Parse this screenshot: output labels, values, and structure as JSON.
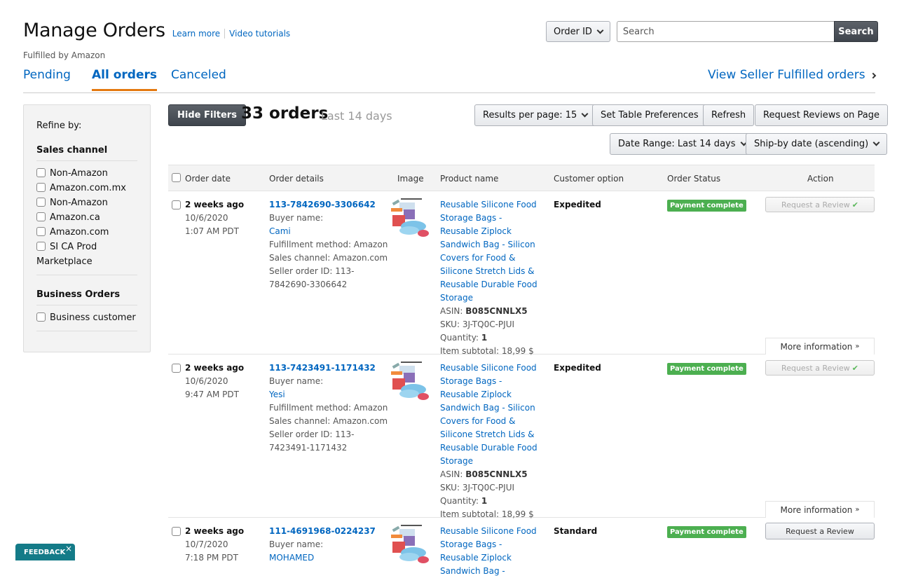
{
  "header": {
    "title": "Manage Orders",
    "learn_more": "Learn more",
    "video_tutorials": "Video tutorials",
    "subtitle": "Fulfilled by Amazon"
  },
  "search": {
    "field_select": "Order ID",
    "placeholder": "Search",
    "button": "Search"
  },
  "tabs": [
    {
      "label": "Pending",
      "active": false
    },
    {
      "label": "All orders",
      "active": true
    },
    {
      "label": "Canceled",
      "active": false
    }
  ],
  "view_seller_link": "View Seller Fulfilled orders",
  "filters": {
    "refine_label": "Refine by:",
    "groups": [
      {
        "title": "Sales channel",
        "options": [
          "Non-Amazon",
          "Amazon.com.mx",
          "Non-Amazon",
          "Amazon.ca",
          "Amazon.com",
          "SI CA Prod Marketplace"
        ]
      },
      {
        "title": "Business Orders",
        "options": [
          "Business customer"
        ]
      }
    ]
  },
  "toolbar": {
    "hide_filters": "Hide Filters",
    "order_count": "33 orders",
    "range_label": "Last 14 days",
    "results_per_page": "Results per page: 15",
    "set_table_prefs": "Set Table Preferences",
    "refresh": "Refresh",
    "request_reviews_page": "Request Reviews on Page",
    "date_range": "Date Range: Last 14 days",
    "sort": "Ship-by date (ascending)"
  },
  "table": {
    "columns": [
      "Order date",
      "Order details",
      "Image",
      "Product name",
      "Customer option",
      "Order Status",
      "Action"
    ],
    "labels": {
      "buyer_name": "Buyer name:",
      "fulfillment": "Fulfillment method: Amazon",
      "sales_channel": "Sales channel: Amazon.com",
      "seller_order_id": "Seller order ID:",
      "asin": "ASIN:",
      "sku": "SKU:",
      "quantity": "Quantity:",
      "subtotal": "Item subtotal:",
      "request_review": "Request a Review",
      "more_info": "More information"
    },
    "rows": [
      {
        "ago": "2 weeks ago",
        "date": "10/6/2020",
        "time": "1:07 AM PDT",
        "order_id": "113-7842690-3306642",
        "buyer": "Cami",
        "seller_order_id_a": "Seller order ID: 113-",
        "seller_order_id_b": "7842690-3306642",
        "product": "Reusable Silicone Food Storage Bags - Reusable Ziplock Sandwich Bag - Silicon Covers for Food & Silicone Stretch Lids & Reusable Durable Food Storage",
        "asin": "B085CNNLX5",
        "sku": "3J-TQ0C-PJUI",
        "quantity": "1",
        "subtotal": "18,99 $",
        "customer_option": "Expedited",
        "status": "Payment complete",
        "review_requested": true
      },
      {
        "ago": "2 weeks ago",
        "date": "10/6/2020",
        "time": "9:47 AM PDT",
        "order_id": "113-7423491-1171432",
        "buyer": "Yesi",
        "seller_order_id_a": "Seller order ID: 113-",
        "seller_order_id_b": "7423491-1171432",
        "product": "Reusable Silicone Food Storage Bags - Reusable Ziplock Sandwich Bag - Silicon Covers for Food & Silicone Stretch Lids & Reusable Durable Food Storage",
        "asin": "B085CNNLX5",
        "sku": "3J-TQ0C-PJUI",
        "quantity": "1",
        "subtotal": "18,99 $",
        "customer_option": "Expedited",
        "status": "Payment complete",
        "review_requested": true
      },
      {
        "ago": "2 weeks ago",
        "date": "10/7/2020",
        "time": "7:18 PM PDT",
        "order_id": "111-4691968-0224237",
        "buyer": "MOHAMED",
        "product": "Reusable Silicone Food Storage Bags - Reusable Ziplock Sandwich Bag -",
        "customer_option": "Standard",
        "status": "Payment complete",
        "review_requested": false
      }
    ]
  },
  "feedback": {
    "label": "FEEDBACK",
    "close": "×"
  },
  "colors": {
    "link": "#0066c0",
    "tab_underline": "#e47911",
    "status_green": "#4caf50",
    "feedback_teal": "#147b88"
  }
}
